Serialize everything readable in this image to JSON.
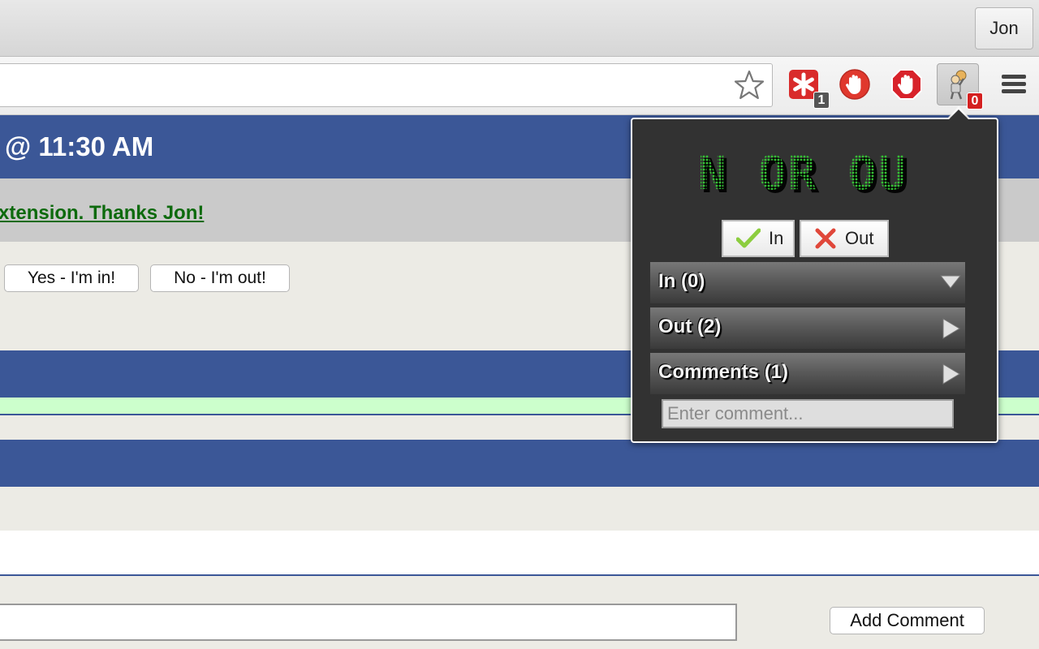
{
  "browser": {
    "profile_name": "Jon",
    "extensions": [
      {
        "name": "asterisk-extension",
        "badge": "1",
        "badge_color": "#555555"
      },
      {
        "name": "hand-extension",
        "badge": ""
      },
      {
        "name": "adblock-extension",
        "badge": ""
      },
      {
        "name": "in-or-out-extension",
        "badge": "0",
        "badge_color": "#d42020"
      }
    ]
  },
  "page": {
    "event_time": "@ 11:30 AM",
    "thanks_text": "xtension. Thanks Jon!",
    "yes_button": "Yes - I'm in!",
    "no_button": "No - I'm out!",
    "comment_value": "",
    "add_comment_button": "Add Comment"
  },
  "popup": {
    "logo_text": "IN OR OUT",
    "in_button": "In",
    "out_button": "Out",
    "sections": [
      {
        "label": "In (0)",
        "expanded": true
      },
      {
        "label": "Out (2)",
        "expanded": false
      },
      {
        "label": "Comments (1)",
        "expanded": false
      }
    ],
    "comment_placeholder": "Enter comment..."
  },
  "colors": {
    "header_blue": "#3b5797",
    "link_green": "#0d6a0d",
    "logo_green": "#2fa82f",
    "popup_bg": "#323232"
  }
}
